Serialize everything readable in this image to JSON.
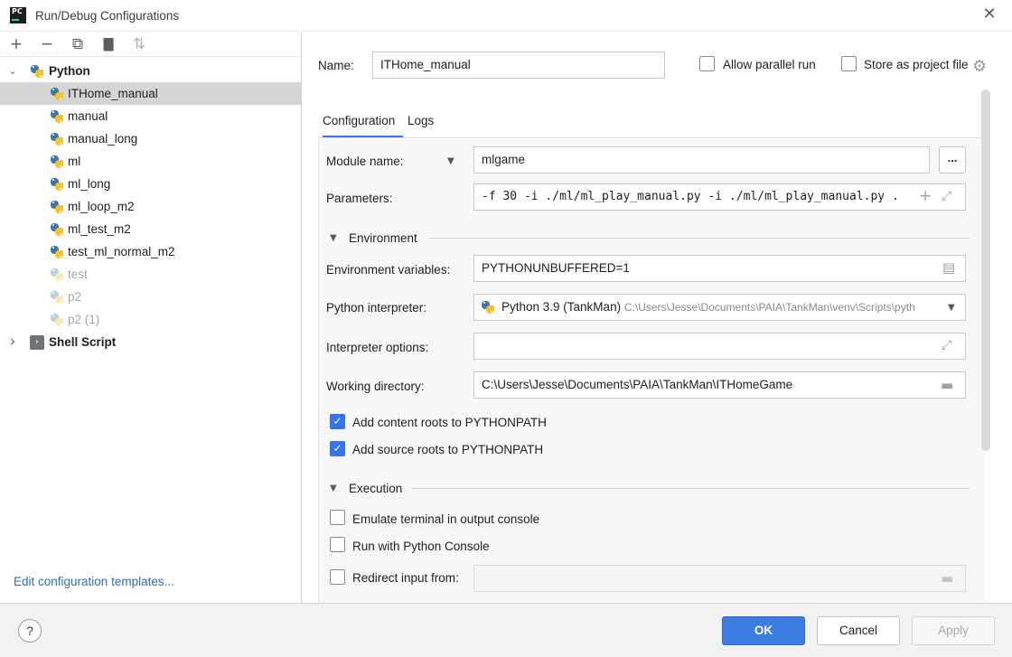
{
  "window": {
    "title": "Run/Debug Configurations",
    "logo_text": "PC",
    "close_glyph": "✕"
  },
  "toolbar": {
    "add_icon": "+",
    "remove_icon": "−",
    "copy_icon": "⧉",
    "folder_icon": "▇",
    "sort_icon": "⇅"
  },
  "tree": {
    "groups": [
      {
        "label": "Python",
        "expanded": true,
        "items": [
          {
            "label": "ITHome_manual",
            "selected": true,
            "dim": false
          },
          {
            "label": "manual",
            "selected": false,
            "dim": false
          },
          {
            "label": "manual_long",
            "selected": false,
            "dim": false
          },
          {
            "label": "ml",
            "selected": false,
            "dim": false
          },
          {
            "label": "ml_long",
            "selected": false,
            "dim": false
          },
          {
            "label": "ml_loop_m2",
            "selected": false,
            "dim": false
          },
          {
            "label": "ml_test_m2",
            "selected": false,
            "dim": false
          },
          {
            "label": "test_ml_normal_m2",
            "selected": false,
            "dim": false
          },
          {
            "label": "test",
            "selected": false,
            "dim": true
          },
          {
            "label": "p2",
            "selected": false,
            "dim": true
          },
          {
            "label": "p2 (1)",
            "selected": false,
            "dim": true
          }
        ]
      },
      {
        "label": "Shell Script",
        "expanded": false,
        "items": []
      }
    ],
    "edit_templates_link": "Edit configuration templates..."
  },
  "form": {
    "name_label": "Name:",
    "name_value": "ITHome_manual",
    "allow_parallel_label": "Allow parallel run",
    "allow_parallel_checked": false,
    "store_project_label": "Store as project file",
    "store_project_checked": false,
    "tabs": [
      {
        "label": "Configuration",
        "active": true
      },
      {
        "label": "Logs",
        "active": false
      }
    ],
    "module_name_label": "Module name:",
    "module_name_value": "mlgame",
    "ellipsis_label": "...",
    "parameters_label": "Parameters:",
    "parameters_value": "-f 30 -i ./ml/ml_play_manual.py -i ./ml/ml_play_manual.py .",
    "environment_section": "Environment",
    "env_vars_label": "Environment variables:",
    "env_vars_value": "PYTHONUNBUFFERED=1",
    "interpreter_label": "Python interpreter:",
    "interpreter_name": "Python 3.9 (TankMan)",
    "interpreter_path": "C:\\Users\\Jesse\\Documents\\PAIA\\TankMan\\venv\\Scripts\\pyth",
    "interpreter_options_label": "Interpreter options:",
    "interpreter_options_value": "",
    "working_dir_label": "Working directory:",
    "working_dir_value": "C:\\Users\\Jesse\\Documents\\PAIA\\TankMan\\ITHomeGame",
    "add_content_roots_label": "Add content roots to PYTHONPATH",
    "add_content_roots_checked": true,
    "add_source_roots_label": "Add source roots to PYTHONPATH",
    "add_source_roots_checked": true,
    "execution_section": "Execution",
    "emulate_terminal_label": "Emulate terminal in output console",
    "emulate_terminal_checked": false,
    "run_console_label": "Run with Python Console",
    "run_console_checked": false,
    "redirect_input_label": "Redirect input from:",
    "redirect_input_checked": false,
    "redirect_input_value": ""
  },
  "buttons": {
    "help": "?",
    "ok": "OK",
    "cancel": "Cancel",
    "apply": "Apply"
  },
  "colors": {
    "accent": "#3574f0",
    "ok_button": "#3b7de0",
    "selection": "#d5d5d5",
    "link": "#2f6db7"
  }
}
